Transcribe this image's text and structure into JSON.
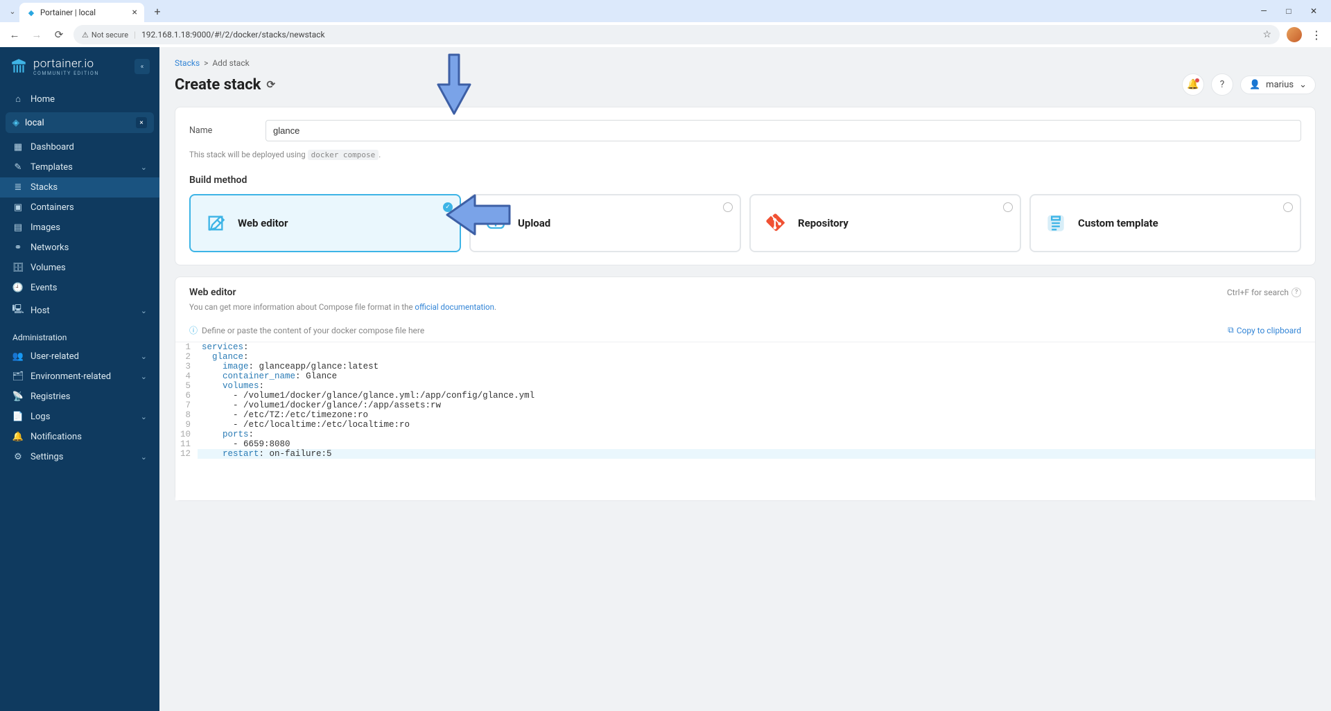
{
  "browser": {
    "tab_title": "Portainer | local",
    "url": "192.168.1.18:9000/#!/2/docker/stacks/newstack",
    "security_label": "Not secure"
  },
  "sidebar": {
    "brand": "portainer.io",
    "edition": "COMMUNITY EDITION",
    "home": "Home",
    "env_name": "local",
    "items": [
      {
        "label": "Dashboard",
        "icon": "dashboard-icon"
      },
      {
        "label": "Templates",
        "icon": "templates-icon",
        "expandable": true
      },
      {
        "label": "Stacks",
        "icon": "stacks-icon",
        "active": true
      },
      {
        "label": "Containers",
        "icon": "containers-icon"
      },
      {
        "label": "Images",
        "icon": "images-icon"
      },
      {
        "label": "Networks",
        "icon": "networks-icon"
      },
      {
        "label": "Volumes",
        "icon": "volumes-icon"
      },
      {
        "label": "Events",
        "icon": "events-icon"
      },
      {
        "label": "Host",
        "icon": "host-icon",
        "expandable": true
      }
    ],
    "admin_title": "Administration",
    "admin_items": [
      {
        "label": "User-related",
        "icon": "user-icon",
        "expandable": true
      },
      {
        "label": "Environment-related",
        "icon": "env-icon",
        "expandable": true
      },
      {
        "label": "Registries",
        "icon": "registries-icon"
      },
      {
        "label": "Logs",
        "icon": "logs-icon",
        "expandable": true
      },
      {
        "label": "Notifications",
        "icon": "notifications-icon"
      },
      {
        "label": "Settings",
        "icon": "settings-icon",
        "expandable": true
      }
    ]
  },
  "header": {
    "breadcrumb_root": "Stacks",
    "breadcrumb_current": "Add stack",
    "page_title": "Create stack",
    "username": "marius"
  },
  "form": {
    "name_label": "Name",
    "name_value": "glance",
    "deploy_hint_pre": "This stack will be deployed using ",
    "deploy_hint_code": "docker compose",
    "deploy_hint_post": ".",
    "build_method_title": "Build method",
    "methods": [
      {
        "label": "Web editor",
        "selected": true,
        "icon": "web-editor"
      },
      {
        "label": "Upload",
        "selected": false,
        "icon": "upload"
      },
      {
        "label": "Repository",
        "selected": false,
        "icon": "repository"
      },
      {
        "label": "Custom template",
        "selected": false,
        "icon": "custom-template"
      }
    ]
  },
  "editor": {
    "title": "Web editor",
    "search_hint": "Ctrl+F for search",
    "desc_pre": "You can get more information about Compose file format in the ",
    "desc_link": "official documentation",
    "desc_post": ".",
    "placeholder_hint": "Define or paste the content of your docker compose file here",
    "copy_label": "Copy to clipboard",
    "lines": [
      {
        "n": 1,
        "tokens": [
          {
            "t": "key",
            "v": "services"
          },
          {
            "t": "p",
            "v": ":"
          }
        ]
      },
      {
        "n": 2,
        "tokens": [
          {
            "t": "sp",
            "v": "  "
          },
          {
            "t": "key",
            "v": "glance"
          },
          {
            "t": "p",
            "v": ":"
          }
        ]
      },
      {
        "n": 3,
        "tokens": [
          {
            "t": "sp",
            "v": "    "
          },
          {
            "t": "key",
            "v": "image"
          },
          {
            "t": "p",
            "v": ": "
          },
          {
            "t": "val",
            "v": "glanceapp/glance:latest"
          }
        ]
      },
      {
        "n": 4,
        "tokens": [
          {
            "t": "sp",
            "v": "    "
          },
          {
            "t": "key",
            "v": "container_name"
          },
          {
            "t": "p",
            "v": ": "
          },
          {
            "t": "val",
            "v": "Glance"
          }
        ]
      },
      {
        "n": 5,
        "tokens": [
          {
            "t": "sp",
            "v": "    "
          },
          {
            "t": "key",
            "v": "volumes"
          },
          {
            "t": "p",
            "v": ":"
          }
        ]
      },
      {
        "n": 6,
        "tokens": [
          {
            "t": "sp",
            "v": "      "
          },
          {
            "t": "p",
            "v": "- "
          },
          {
            "t": "val",
            "v": "/volume1/docker/glance/glance.yml:/app/config/glance.yml"
          }
        ]
      },
      {
        "n": 7,
        "tokens": [
          {
            "t": "sp",
            "v": "      "
          },
          {
            "t": "p",
            "v": "- "
          },
          {
            "t": "val",
            "v": "/volume1/docker/glance/:/app/assets:rw"
          }
        ]
      },
      {
        "n": 8,
        "tokens": [
          {
            "t": "sp",
            "v": "      "
          },
          {
            "t": "p",
            "v": "- "
          },
          {
            "t": "val",
            "v": "/etc/TZ:/etc/timezone:ro"
          }
        ]
      },
      {
        "n": 9,
        "tokens": [
          {
            "t": "sp",
            "v": "      "
          },
          {
            "t": "p",
            "v": "- "
          },
          {
            "t": "val",
            "v": "/etc/localtime:/etc/localtime:ro"
          }
        ]
      },
      {
        "n": 10,
        "tokens": [
          {
            "t": "sp",
            "v": "    "
          },
          {
            "t": "key",
            "v": "ports"
          },
          {
            "t": "p",
            "v": ":"
          }
        ]
      },
      {
        "n": 11,
        "tokens": [
          {
            "t": "sp",
            "v": "      "
          },
          {
            "t": "p",
            "v": "- "
          },
          {
            "t": "val",
            "v": "6659:8080"
          }
        ]
      },
      {
        "n": 12,
        "current": true,
        "tokens": [
          {
            "t": "sp",
            "v": "    "
          },
          {
            "t": "key",
            "v": "restart"
          },
          {
            "t": "p",
            "v": ": "
          },
          {
            "t": "val",
            "v": "on-failure:5"
          }
        ]
      }
    ]
  }
}
